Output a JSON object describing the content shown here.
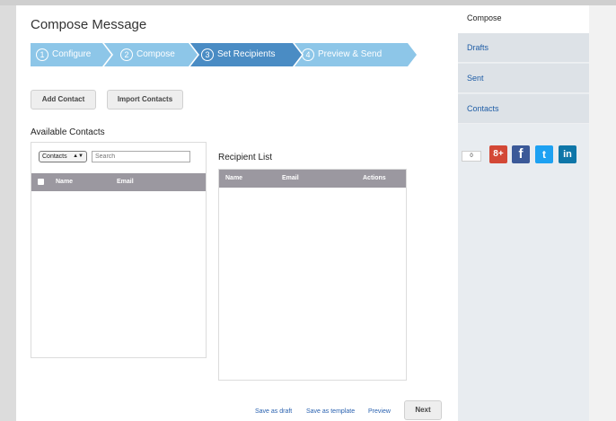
{
  "page": {
    "title": "Compose Message"
  },
  "wizard": {
    "steps": [
      {
        "num": "1",
        "label": "Configure"
      },
      {
        "num": "2",
        "label": "Compose"
      },
      {
        "num": "3",
        "label": "Set Recipients"
      },
      {
        "num": "4",
        "label": "Preview & Send"
      }
    ],
    "active_index": 2
  },
  "toolbar": {
    "add_contact": "Add Contact",
    "import_contacts": "Import Contacts"
  },
  "available_contacts": {
    "heading": "Available Contacts",
    "filter_value": "Contacts",
    "search_placeholder": "Search",
    "columns": [
      "Name",
      "Email"
    ]
  },
  "recipient_list": {
    "heading": "Recipient List",
    "columns": [
      "Name",
      "Email",
      "Actions"
    ]
  },
  "footer": {
    "save_draft": "Save as draft",
    "save_template": "Save as template",
    "preview": "Preview",
    "next": "Next"
  },
  "sidebar": {
    "compose": "Compose",
    "items": [
      "Drafts",
      "Sent",
      "Contacts"
    ]
  },
  "social": {
    "count": "0",
    "google_plus": "8+",
    "facebook": "f",
    "twitter": "t",
    "linkedin": "in"
  },
  "colors": {
    "step_inactive": "#8dc6e8",
    "step_active": "#4a8cc4",
    "table_header": "#9b98a0",
    "link": "#2a62b0",
    "google_plus": "#d34836",
    "facebook": "#3b5998",
    "twitter": "#1da1f2",
    "linkedin": "#0e76a8"
  }
}
